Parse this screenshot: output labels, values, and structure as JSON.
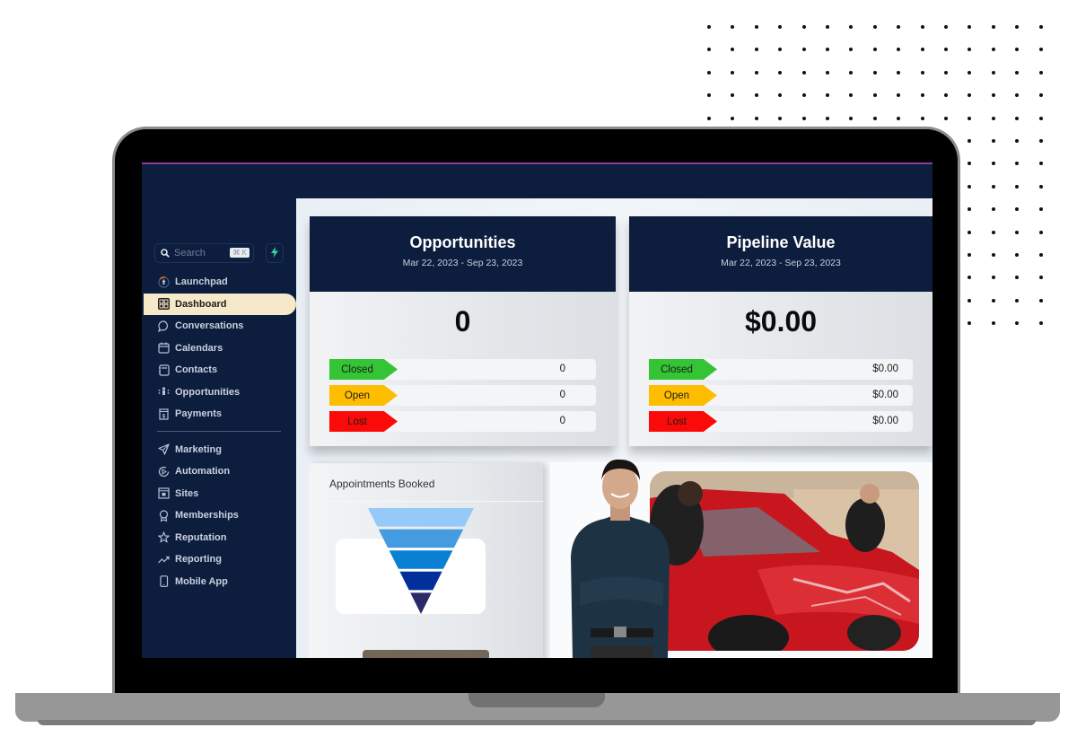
{
  "sidebar": {
    "search": {
      "placeholder": "Search",
      "shortcut": "⌘ K"
    },
    "quick_action_icon": "lightning-icon",
    "items": [
      {
        "label": "Launchpad",
        "icon": "rocket-icon",
        "active": false
      },
      {
        "label": "Dashboard",
        "icon": "dashboard-grid-icon",
        "active": true
      },
      {
        "label": "Conversations",
        "icon": "chat-bubble-icon",
        "active": false
      },
      {
        "label": "Calendars",
        "icon": "calendar-icon",
        "active": false
      },
      {
        "label": "Contacts",
        "icon": "contact-book-icon",
        "active": false
      },
      {
        "label": "Opportunities",
        "icon": "opportunities-icon",
        "active": false
      },
      {
        "label": "Payments",
        "icon": "receipt-icon",
        "active": false
      }
    ],
    "items_secondary": [
      {
        "label": "Marketing",
        "icon": "send-icon"
      },
      {
        "label": "Automation",
        "icon": "play-circle-icon"
      },
      {
        "label": "Sites",
        "icon": "browser-icon"
      },
      {
        "label": "Memberships",
        "icon": "award-icon"
      },
      {
        "label": "Reputation",
        "icon": "star-icon"
      },
      {
        "label": "Reporting",
        "icon": "trend-up-icon"
      },
      {
        "label": "Mobile App",
        "icon": "phone-icon"
      }
    ]
  },
  "opportunities": {
    "title": "Opportunities",
    "date_range": "Mar 22, 2023 - Sep 23, 2023",
    "total": "0",
    "rows": [
      {
        "label": "Closed",
        "value": "0",
        "color": "#35c435"
      },
      {
        "label": "Open",
        "value": "0",
        "color": "#ffbd00"
      },
      {
        "label": "Lost",
        "value": "0",
        "color": "#fb0a0a"
      }
    ]
  },
  "pipeline": {
    "title": "Pipeline Value",
    "date_range": "Mar 22, 2023 - Sep 23, 2023",
    "total": "$0.00",
    "rows": [
      {
        "label": "Closed",
        "value": "$0.00",
        "color": "#35c435"
      },
      {
        "label": "Open",
        "value": "$0.00",
        "color": "#ffbd00"
      },
      {
        "label": "Lost",
        "value": "$0.00",
        "color": "#fb0a0a"
      }
    ]
  },
  "appointments": {
    "title": "Appointments Booked",
    "funnel_colors": [
      "#94c9fa",
      "#459be0",
      "#0a80d4",
      "#01309c",
      "#2a2a6a"
    ]
  },
  "promo": {
    "person_image": "smiling-man-crossed-arms",
    "photo": "car-detailing-red-car"
  }
}
